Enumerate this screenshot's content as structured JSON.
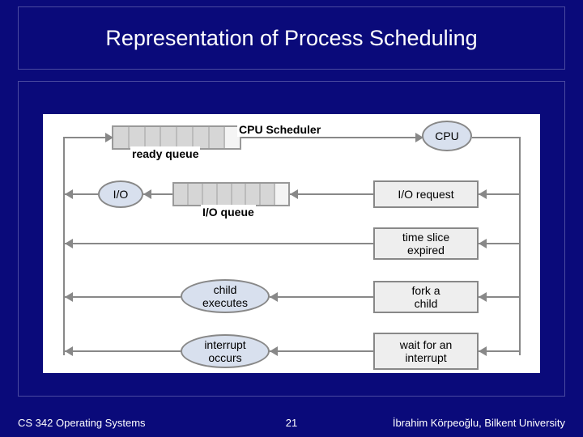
{
  "title": "Representation of Process Scheduling",
  "labels": {
    "cpu_scheduler": "CPU Scheduler",
    "ready_queue": "ready queue",
    "io_queue": "I/O queue"
  },
  "nodes": {
    "cpu": "CPU",
    "io": "I/O",
    "io_request": "I/O request",
    "time_slice": "time slice\nexpired",
    "child_exec": "child\nexecutes",
    "fork_child": "fork a\nchild",
    "interrupt_occurs": "interrupt\noccurs",
    "wait_interrupt": "wait for an\ninterrupt"
  },
  "footer": {
    "left": "CS 342 Operating Systems",
    "center": "21",
    "right": "İbrahim Körpeoğlu, Bilkent University"
  }
}
